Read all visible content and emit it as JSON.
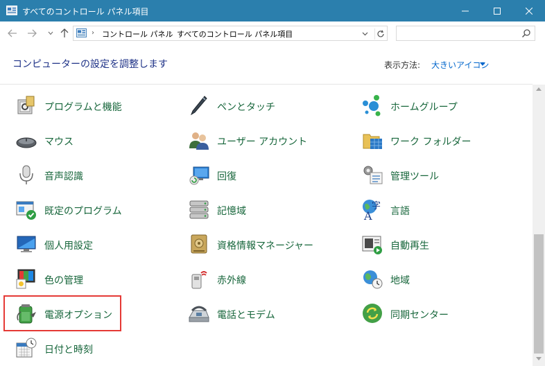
{
  "window": {
    "title": "すべてのコントロール パネル項目",
    "accent_color": "#2b7fad",
    "buttons": {
      "minimize": "minimize-icon",
      "maximize": "maximize-icon",
      "close": "close-icon"
    }
  },
  "nav": {
    "breadcrumbs": [
      "コントロール パネル",
      "すべてのコントロール パネル項目"
    ],
    "search_placeholder": ""
  },
  "header": {
    "title": "コンピューターの設定を調整します",
    "view_by_label": "表示方法:",
    "view_by_value": "大きいアイコン"
  },
  "items": [
    {
      "label": "プログラムと機能",
      "icon": "programs-features-icon"
    },
    {
      "label": "ペンとタッチ",
      "icon": "pen-touch-icon"
    },
    {
      "label": "ホームグループ",
      "icon": "homegroup-icon"
    },
    {
      "label": "マウス",
      "icon": "mouse-icon"
    },
    {
      "label": "ユーザー アカウント",
      "icon": "user-accounts-icon"
    },
    {
      "label": "ワーク フォルダー",
      "icon": "work-folders-icon"
    },
    {
      "label": "音声認識",
      "icon": "microphone-icon"
    },
    {
      "label": "回復",
      "icon": "recovery-icon"
    },
    {
      "label": "管理ツール",
      "icon": "admin-tools-icon"
    },
    {
      "label": "既定のプログラム",
      "icon": "default-programs-icon"
    },
    {
      "label": "記憶域",
      "icon": "storage-spaces-icon"
    },
    {
      "label": "言語",
      "icon": "language-icon"
    },
    {
      "label": "個人用設定",
      "icon": "personalization-icon"
    },
    {
      "label": "資格情報マネージャー",
      "icon": "credential-manager-icon"
    },
    {
      "label": "自動再生",
      "icon": "autoplay-icon"
    },
    {
      "label": "色の管理",
      "icon": "color-management-icon"
    },
    {
      "label": "赤外線",
      "icon": "infrared-icon"
    },
    {
      "label": "地域",
      "icon": "region-icon"
    },
    {
      "label": "電源オプション",
      "icon": "power-options-icon"
    },
    {
      "label": "電話とモデム",
      "icon": "phone-modem-icon"
    },
    {
      "label": "同期センター",
      "icon": "sync-center-icon"
    },
    {
      "label": "日付と時刻",
      "icon": "date-time-icon"
    }
  ],
  "highlighted_item": "電源オプション",
  "highlight_color": "#e53935",
  "label_color": "#17663b"
}
